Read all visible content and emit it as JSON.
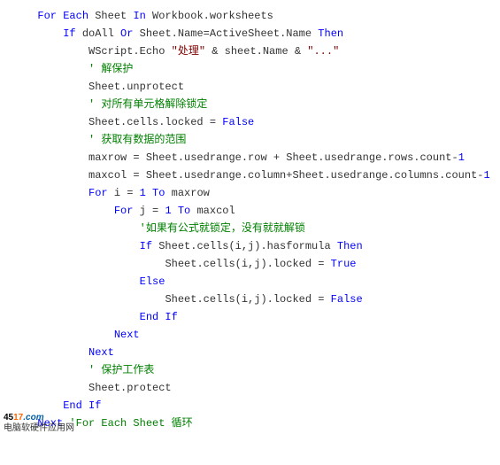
{
  "code": {
    "l1": {
      "pre": "  ",
      "kw1": "For Each",
      "mid": " Sheet ",
      "kw2": "In",
      "post": " Workbook.worksheets",
      "ghost": ""
    },
    "l2": {
      "pre": "      ",
      "kw1": "If",
      "mid1": " doAll ",
      "kw2": "Or",
      "mid2": " Sheet.Name=ActiveSheet.Name ",
      "kw3": "Then",
      "ghost": ""
    },
    "l3": {
      "pre": "          ",
      "a": "WScript.Echo ",
      "s1": "\"处理\"",
      "b": " & sheet.Name & ",
      "s2": "\"...\"",
      "ghost": ""
    },
    "l4": {
      "pre": "          ",
      "cmt": "' 解保护",
      "ghost": ""
    },
    "l5": {
      "pre": "          ",
      "txt": "Sheet.unprotect",
      "ghost": ""
    },
    "l6": {
      "pre": "          ",
      "cmt": "' 对所有单元格解除锁定",
      "ghost": ""
    },
    "l7": {
      "pre": "          ",
      "a": "Sheet.cells.locked = ",
      "kw": "False",
      "ghost": ""
    },
    "l8": {
      "pre": "          ",
      "cmt": "' 获取有数据的范围",
      "ghost": ""
    },
    "l9": {
      "pre": "          ",
      "a": "maxrow = Sheet.usedrange.row + Sheet.usedrange.rows.count-",
      "n": "1",
      "ghost": ""
    },
    "l10": {
      "pre": "          ",
      "a": "maxcol = Sheet.usedrange.column+Sheet.usedrange.columns.count-",
      "n": "1",
      "ghost": ""
    },
    "l11": {
      "pre": "          ",
      "kw1": "For",
      "a": " i = ",
      "n": "1",
      "sp": " ",
      "kw2": "To",
      "b": " maxrow",
      "ghost": ""
    },
    "l12": {
      "pre": "              ",
      "kw1": "For",
      "a": " j = ",
      "n": "1",
      "sp": " ",
      "kw2": "To",
      "b": " maxcol",
      "ghost": ""
    },
    "l13": {
      "pre": "                  ",
      "cmt": "'如果有公式就锁定，没有就就解锁",
      "ghost": ""
    },
    "l14": {
      "pre": "                  ",
      "kw1": "If",
      "a": " Sheet.cells(i,j).hasformula ",
      "kw2": "Then",
      "ghost": ""
    },
    "l15": {
      "pre": "                      ",
      "a": "Sheet.cells(i,j).locked = ",
      "kw": "True",
      "ghost": ""
    },
    "l16": {
      "pre": "                  ",
      "kw": "Else",
      "ghost": ""
    },
    "l17": {
      "pre": "                      ",
      "a": "Sheet.cells(i,j).locked = ",
      "kw": "False",
      "ghost": ""
    },
    "l18": {
      "pre": "                  ",
      "kw": "End If",
      "ghost": ""
    },
    "l19": {
      "pre": "              ",
      "kw": "Next",
      "ghost": ""
    },
    "l20": {
      "pre": "          ",
      "kw": "Next",
      "ghost": ""
    },
    "l21": {
      "pre": "          ",
      "cmt": "' 保护工作表",
      "ghost": ""
    },
    "l22": {
      "pre": "          ",
      "txt": "Sheet.protect",
      "ghost": ""
    },
    "l23": {
      "pre": "      ",
      "kw": "End If",
      "ghost": ""
    },
    "l24": {
      "pre": "  ",
      "kw": "Next",
      "cmt": " 'For Each Sheet 循环",
      "ghost": ""
    }
  },
  "watermark": {
    "d": "45",
    "n": "17",
    "com": ".com",
    "sub": "电脑软硬件应用网"
  }
}
